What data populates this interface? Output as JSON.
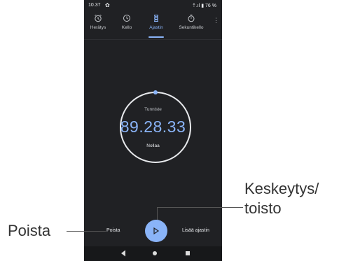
{
  "status": {
    "time": "10.37",
    "right": "⇡.ıl ▮ 76 %"
  },
  "tabs": [
    {
      "label": "Herätys",
      "icon": "alarm-icon"
    },
    {
      "label": "Kello",
      "icon": "clock-icon"
    },
    {
      "label": "Ajastin",
      "icon": "hourglass-icon",
      "active": true
    },
    {
      "label": "Sekuntikello",
      "icon": "stopwatch-icon"
    }
  ],
  "timer": {
    "name": "Tunniste",
    "value": "89.28.33",
    "reset_label": "Nollaa"
  },
  "actions": {
    "delete_label": "Poista",
    "add_label": "Lisää ajastin"
  },
  "annotations": {
    "pause_play_line1": "Keskeytys/",
    "pause_play_line2": "toisto",
    "delete": "Poista"
  },
  "colors": {
    "accent": "#8ab4f8",
    "background": "#202124"
  }
}
